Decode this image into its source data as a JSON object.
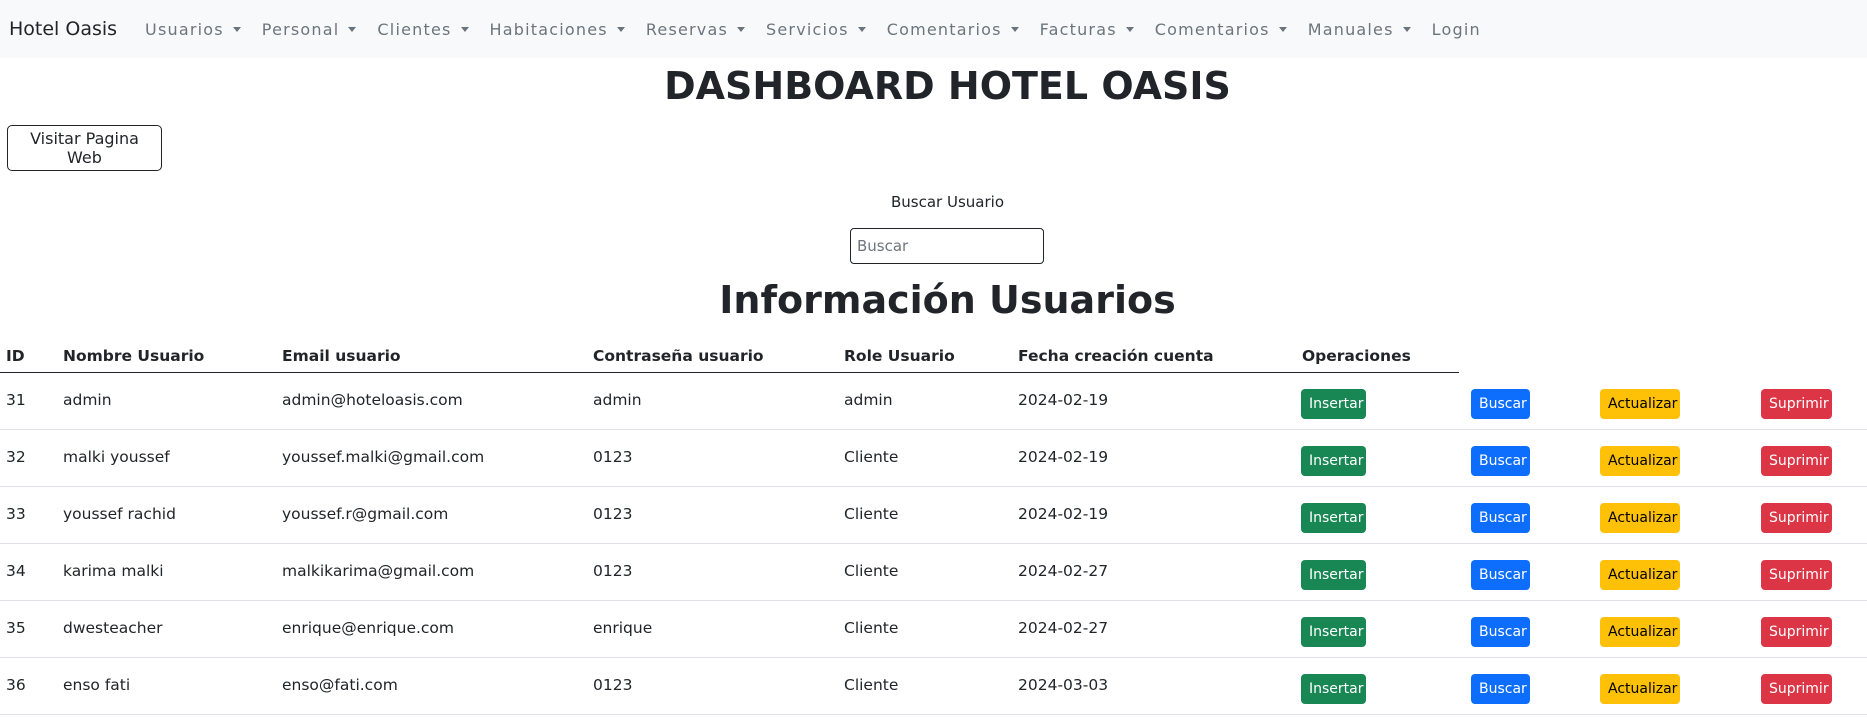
{
  "navbar": {
    "brand": "Hotel Oasis",
    "items": [
      {
        "label": "Usuarios",
        "dropdown": true
      },
      {
        "label": "Personal",
        "dropdown": true
      },
      {
        "label": "Clientes",
        "dropdown": true
      },
      {
        "label": "Habitaciones",
        "dropdown": true
      },
      {
        "label": "Reservas",
        "dropdown": true
      },
      {
        "label": "Servicios",
        "dropdown": true
      },
      {
        "label": "Comentarios",
        "dropdown": true
      },
      {
        "label": "Facturas",
        "dropdown": true
      },
      {
        "label": "Comentarios",
        "dropdown": true
      },
      {
        "label": "Manuales",
        "dropdown": true
      },
      {
        "label": "Login",
        "dropdown": false
      }
    ]
  },
  "page": {
    "title": "DASHBOARD HOTEL OASIS",
    "visit_button": "Visitar Pagina Web",
    "search_label": "Buscar Usuario",
    "search_placeholder": "Buscar",
    "section_title": "Información Usuarios"
  },
  "table": {
    "headers": [
      "ID",
      "Nombre Usuario",
      "Email usuario",
      "Contraseña usuario",
      "Role Usuario",
      "Fecha creación cuenta",
      "Operaciones"
    ],
    "rows": [
      [
        "31",
        "admin",
        "admin@hoteloasis.com",
        "admin",
        "admin",
        "2024-02-19"
      ],
      [
        "32",
        "malki youssef",
        "youssef.malki@gmail.com",
        "0123",
        "Cliente",
        "2024-02-19"
      ],
      [
        "33",
        "youssef rachid",
        "youssef.r@gmail.com",
        "0123",
        "Cliente",
        "2024-02-19"
      ],
      [
        "34",
        "karima malki",
        "malkikarima@gmail.com",
        "0123",
        "Cliente",
        "2024-02-27"
      ],
      [
        "35",
        "dwesteacher",
        "enrique@enrique.com",
        "enrique",
        "Cliente",
        "2024-02-27"
      ],
      [
        "36",
        "enso fati",
        "enso@fati.com",
        "0123",
        "Cliente",
        "2024-03-03"
      ]
    ],
    "operations": {
      "insert": "Insertar",
      "search": "Buscar",
      "update": "Actualizar",
      "delete": "Suprimir"
    }
  },
  "colors": {
    "insert": "#198754",
    "search": "#0d6efd",
    "update": "#ffc107",
    "delete": "#dc3545",
    "navbar_bg": "#f8f9fa"
  }
}
